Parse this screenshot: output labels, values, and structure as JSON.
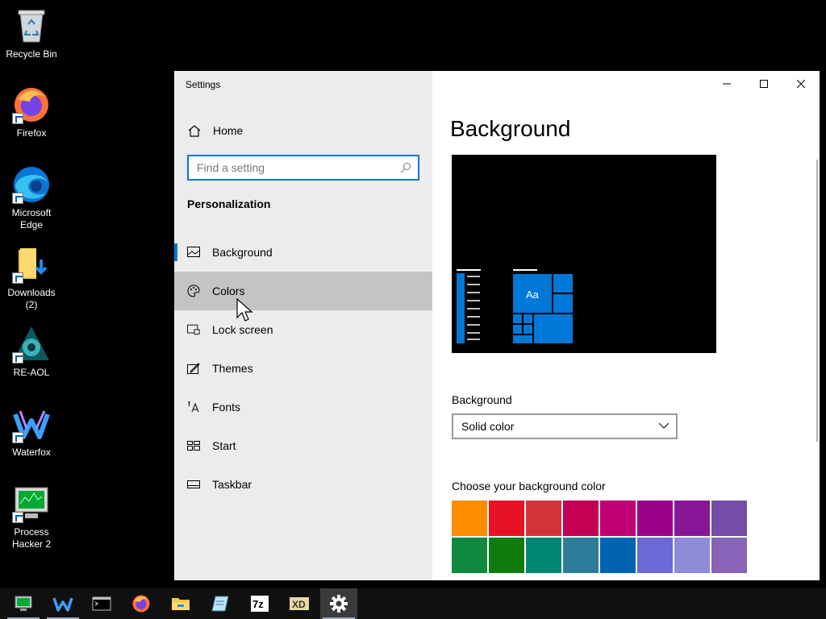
{
  "desktop": {
    "icons": [
      {
        "label": "Recycle Bin",
        "icon": "recycle-bin-icon"
      },
      {
        "label": "Firefox",
        "icon": "firefox-icon"
      },
      {
        "label": "Microsoft Edge",
        "icon": "edge-icon"
      },
      {
        "label": "Downloads (2)",
        "icon": "folder-download-icon"
      },
      {
        "label": "RE-AOL",
        "icon": "aol-icon"
      },
      {
        "label": "Waterfox",
        "icon": "waterfox-icon"
      },
      {
        "label": "Process Hacker 2",
        "icon": "process-hacker-icon"
      }
    ]
  },
  "window": {
    "title": "Settings",
    "sidebar": {
      "home_label": "Home",
      "search_placeholder": "Find a setting",
      "section_title": "Personalization",
      "items": [
        {
          "label": "Background",
          "icon": "picture-icon",
          "state": "selected"
        },
        {
          "label": "Colors",
          "icon": "palette-icon",
          "state": "hover"
        },
        {
          "label": "Lock screen",
          "icon": "lock-screen-icon"
        },
        {
          "label": "Themes",
          "icon": "themes-icon"
        },
        {
          "label": "Fonts",
          "icon": "fonts-icon"
        },
        {
          "label": "Start",
          "icon": "start-icon"
        },
        {
          "label": "Taskbar",
          "icon": "taskbar-icon"
        }
      ]
    },
    "main": {
      "heading": "Background",
      "preview_tile_text": "Aa",
      "background_label": "Background",
      "background_value": "Solid color",
      "color_label": "Choose your background color",
      "swatches": [
        "#ff8c00",
        "#e81123",
        "#d13438",
        "#c30052",
        "#bf0077",
        "#9a0089",
        "#881798",
        "#744da9",
        "#10893e",
        "#107c10",
        "#018574",
        "#2d7d9a",
        "#0063b1",
        "#6b69d6",
        "#8e8cd8",
        "#8764b8"
      ]
    }
  },
  "taskbar": {
    "items": [
      "monitor-icon",
      "waterfox-icon",
      "terminal-icon",
      "firefox-icon",
      "file-explorer-icon",
      "notepad-icon",
      "7zip-icon",
      "xd-icon",
      "gear-icon"
    ]
  },
  "colors": {
    "accent": "#0078d7"
  }
}
